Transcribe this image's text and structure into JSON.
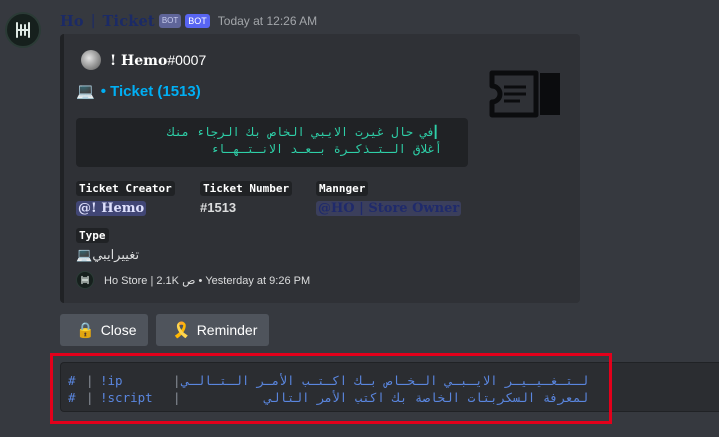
{
  "message": {
    "username": "Ho",
    "separator": "|",
    "username2": "Ticket",
    "badge_app": "BOT",
    "badge_bot": "BOT",
    "timestamp": "Today at 12:26 AM"
  },
  "embed": {
    "author": "! Hemo",
    "author_discriminator": "#0007",
    "title_emoji": "💻",
    "title": "• Ticket (1513)",
    "code_lines": [
      "في حال غيرت الايبي الخاص بك الرجاء منك",
      "أغلاق الـتـذكـرة بـعـد الانـتـهـاء"
    ],
    "fields": {
      "creator": {
        "name": "Ticket Creator",
        "value": "@! Hemo"
      },
      "number": {
        "name": "Ticket Number",
        "value": "#1513"
      },
      "manager": {
        "name": "Mannger",
        "value": "@HO | Store Owner"
      },
      "type": {
        "name": "Type",
        "value_emoji": "💻",
        "value": "تغييرايبي"
      }
    },
    "footer": "Ho Store | 2.1K ص • Yesterday at 9:26 PM",
    "thumbnail_icon": "ticket-icon"
  },
  "buttons": {
    "close": {
      "emoji": "🔒",
      "label": "Close"
    },
    "reminder": {
      "emoji": "🎗️",
      "label": "Reminder"
    }
  },
  "commands": [
    {
      "hash": "#",
      "bar": "|",
      "command": "!ip",
      "bar2": "|",
      "description": "لـتـغـيـيـر الايـبـي الـخـاص بـك اكـتـب الأمـر الـتـالـي"
    },
    {
      "hash": "#",
      "bar": "|",
      "command": "!script",
      "bar2": "|",
      "description": "لمعرفة السكربتات الخاصة بك اكتب الأمر التالي"
    }
  ],
  "colors": {
    "background": "#36393f",
    "embed_background": "#2f3136",
    "title_link": "#00aff4",
    "code_green": "#2ed0a8",
    "command_blue": "#5a86df",
    "highlight_red": "#e3001b"
  }
}
